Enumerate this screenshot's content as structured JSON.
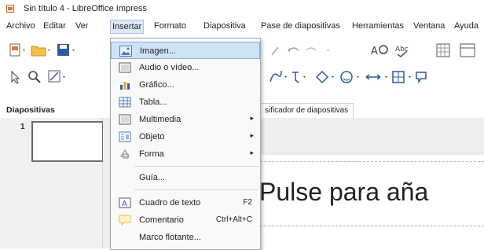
{
  "window": {
    "title": "Sin título 4 - LibreOffice Impress"
  },
  "menubar": {
    "items": [
      "Archivo",
      "Editar",
      "Ver",
      "Insertar",
      "Formato",
      "Diapositiva",
      "Pase de diapositivas",
      "Herramientas",
      "Ventana",
      "Ayuda"
    ]
  },
  "panel": {
    "title": "Diapositivas",
    "slide_number": "1"
  },
  "tabs": {
    "active": "sificador de diapositivas"
  },
  "slide": {
    "title_placeholder": "Pulse para aña"
  },
  "insert_menu": {
    "items": [
      {
        "label": "Imagen...",
        "icon": "image-icon",
        "highlighted": true
      },
      {
        "label": "Audio o vídeo...",
        "icon": "media-icon"
      },
      {
        "label": "Gráfico...",
        "icon": "chart-icon"
      },
      {
        "label": "Tabla...",
        "icon": "table-icon"
      },
      {
        "label": "Multimedia",
        "icon": "multimedia-icon",
        "submenu": true
      },
      {
        "label": "Objeto",
        "icon": "object-icon",
        "submenu": true
      },
      {
        "label": "Forma",
        "icon": "shape-icon",
        "submenu": true
      },
      {
        "label": "Guía..."
      },
      {
        "label": "Cuadro de texto",
        "icon": "textbox-icon",
        "shortcut": "F2"
      },
      {
        "label": "Comentario",
        "icon": "comment-icon",
        "shortcut": "Ctrl+Alt+C"
      },
      {
        "label": "Marco flotante..."
      }
    ]
  }
}
